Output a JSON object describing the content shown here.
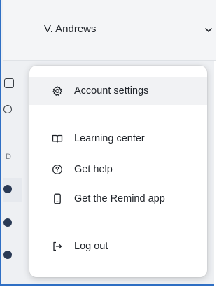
{
  "header": {
    "user_name": "V. Andrews"
  },
  "menu": {
    "items": [
      {
        "label": "Account settings",
        "icon": "gear-icon"
      },
      {
        "label": "Learning center",
        "icon": "book-icon"
      },
      {
        "label": "Get help",
        "icon": "help-icon"
      },
      {
        "label": "Get the Remind app",
        "icon": "phone-icon"
      },
      {
        "label": "Log out",
        "icon": "logout-icon"
      }
    ]
  },
  "background": {
    "section_letter": "D"
  },
  "colors": {
    "accent_border": "#2f6fc4",
    "menu_highlight": "#f1f2f4",
    "text": "#1f2329"
  }
}
